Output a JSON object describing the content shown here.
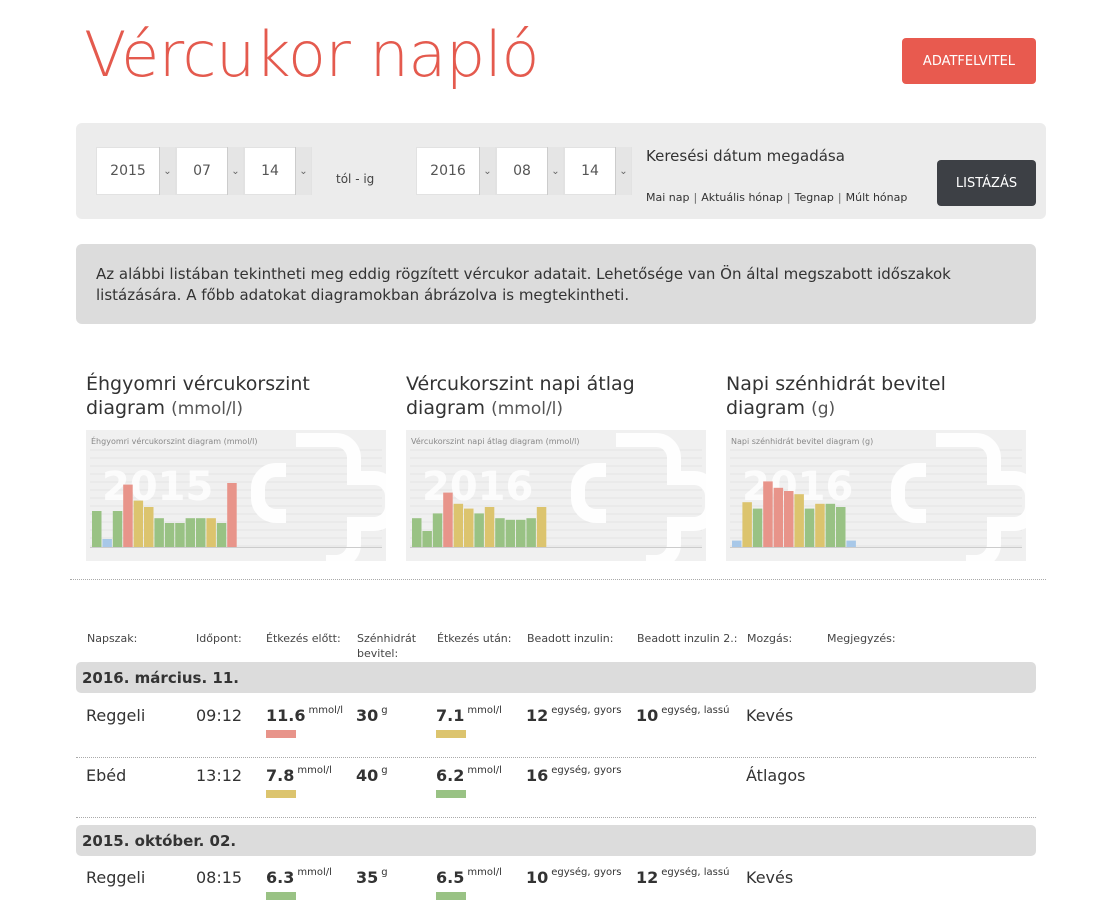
{
  "header": {
    "title": "Vércukor napló",
    "add_button": "ADATFELVITEL"
  },
  "search": {
    "from": {
      "year": "2015",
      "month": "07",
      "day": "14"
    },
    "to": {
      "year": "2016",
      "month": "08",
      "day": "14"
    },
    "range_label": "tól - ig",
    "label": "Keresési dátum megadása",
    "quick_links": [
      "Mai nap",
      "Aktuális hónap",
      "Tegnap",
      "Múlt hónap"
    ],
    "list_button": "LISTÁZÁS"
  },
  "info_text": "Az alábbi listában tekintheti meg eddig rögzített vércukor adatait. Lehetősége van Ön által megszabott időszakok listázására. A főbb adatokat diagramokban ábrázolva is megtekintheti.",
  "charts": [
    {
      "title": "Éhgyomri vércukorszint diagram",
      "unit": "(mmol/l)",
      "inner_title": "Éhgyomri vércukorszint diagram (mmol/l)",
      "watermark_year": "2015",
      "bar_levels": [
        0.45,
        0.1,
        0.45,
        0.78,
        0.58,
        0.5,
        0.36,
        0.3,
        0.3,
        0.36,
        0.36,
        0.36,
        0.3,
        0.8
      ],
      "bar_colors": [
        "#99c284",
        "#a8c8e8",
        "#99c284",
        "#e8948a",
        "#dcc46e",
        "#dcc46e",
        "#99c284",
        "#99c284",
        "#99c284",
        "#99c284",
        "#99c284",
        "#dcc46e",
        "#99c284",
        "#e8948a"
      ]
    },
    {
      "title": "Vércukorszint napi átlag diagram",
      "unit": "(mmol/l)",
      "inner_title": "Vércukorszint napi átlag diagram (mmol/l)",
      "watermark_year": "2016",
      "bar_levels": [
        0.36,
        0.2,
        0.42,
        0.68,
        0.54,
        0.48,
        0.42,
        0.5,
        0.36,
        0.34,
        0.34,
        0.36,
        0.5
      ],
      "bar_colors": [
        "#99c284",
        "#99c284",
        "#99c284",
        "#e8948a",
        "#dcc46e",
        "#dcc46e",
        "#99c284",
        "#dcc46e",
        "#99c284",
        "#99c284",
        "#99c284",
        "#99c284",
        "#dcc46e"
      ]
    },
    {
      "title": "Napi szénhidrát bevitel diagram",
      "unit": "(g)",
      "inner_title": "Napi szénhidrát bevitel diagram (g)",
      "watermark_year": "2016",
      "bar_levels": [
        0.08,
        0.56,
        0.48,
        0.82,
        0.74,
        0.7,
        0.66,
        0.48,
        0.54,
        0.54,
        0.5,
        0.08
      ],
      "bar_colors": [
        "#a8c8e8",
        "#dcc46e",
        "#99c284",
        "#e8948a",
        "#e8948a",
        "#e8948a",
        "#dcc46e",
        "#99c284",
        "#dcc46e",
        "#99c284",
        "#99c284",
        "#a8c8e8"
      ]
    }
  ],
  "table": {
    "headers": [
      "Napszak:",
      "Időpont:",
      "Étkezés előtt:",
      "Szénhidrát bevitel:",
      "Étkezés után:",
      "Beadott inzulin:",
      "Beadott inzulin 2.:",
      "Mozgás:",
      "Megjegyzés:"
    ],
    "groups": [
      {
        "date": "2016. március. 11.",
        "rows": [
          {
            "napszak": "Reggeli",
            "time": "09:12",
            "before": "11.6",
            "before_unit": "mmol/l",
            "before_color": "red",
            "carb": "30",
            "carb_unit": "g",
            "after": "7.1",
            "after_unit": "mmol/l",
            "after_color": "yellow",
            "ins1": "12",
            "ins1_unit": "egység, gyors",
            "ins2": "10",
            "ins2_unit": "egység, lassú",
            "move": "Kevés"
          },
          {
            "napszak": "Ebéd",
            "time": "13:12",
            "before": "7.8",
            "before_unit": "mmol/l",
            "before_color": "yellow",
            "carb": "40",
            "carb_unit": "g",
            "after": "6.2",
            "after_unit": "mmol/l",
            "after_color": "green",
            "ins1": "16",
            "ins1_unit": "egység, gyors",
            "ins2": "",
            "ins2_unit": "",
            "move": "Átlagos"
          }
        ]
      },
      {
        "date": "2015. október. 02.",
        "rows": [
          {
            "napszak": "Reggeli",
            "time": "08:15",
            "before": "6.3",
            "before_unit": "mmol/l",
            "before_color": "green",
            "carb": "35",
            "carb_unit": "g",
            "after": "6.5",
            "after_unit": "mmol/l",
            "after_color": "green",
            "ins1": "10",
            "ins1_unit": "egység, gyors",
            "ins2": "12",
            "ins2_unit": "egység, lassú",
            "move": "Kevés"
          }
        ]
      }
    ]
  }
}
